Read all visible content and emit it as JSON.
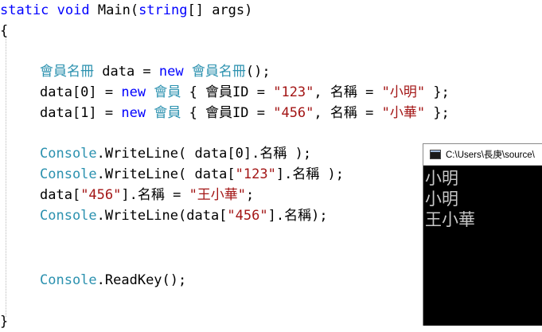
{
  "code": {
    "line1": {
      "static_kw": "static",
      "void_kw": "void",
      "method": "Main(",
      "string_kw": "string",
      "rest": "[] args)"
    },
    "line2": {
      "brace": "{"
    },
    "line3": {
      "type": "會員名冊",
      "mid": " data = ",
      "new_kw": "new",
      "sp": " ",
      "ctor": "會員名冊",
      "end": "();"
    },
    "line4": {
      "start": "data[0] = ",
      "new_kw": "new",
      "sp": " ",
      "type": "會員",
      "mid": " { 會員ID = ",
      "str1": "\"123\"",
      "mid2": ", 名稱 = ",
      "str2": "\"小明\"",
      "end": " };"
    },
    "line5": {
      "start": "data[1] = ",
      "new_kw": "new",
      "sp": " ",
      "type": "會員",
      "mid": " { 會員ID = ",
      "str1": "\"456\"",
      "mid2": ", 名稱 = ",
      "str2": "\"小華\"",
      "end": " };"
    },
    "line6": {
      "type": "Console",
      "mid": ".WriteLine( data[0].名稱 );"
    },
    "line7": {
      "type": "Console",
      "mid": ".WriteLine( data[",
      "str": "\"123\"",
      "end": "].名稱 );"
    },
    "line8": {
      "start": "data[",
      "str1": "\"456\"",
      "mid": "].名稱 = ",
      "str2": "\"王小華\"",
      "end": ";"
    },
    "line9": {
      "type": "Console",
      "mid": ".WriteLine(data[",
      "str": "\"456\"",
      "end": "].名稱);"
    },
    "line10": {
      "type": "Console",
      "mid": ".ReadKey();"
    },
    "line11": {
      "brace": "}"
    }
  },
  "console": {
    "title": "C:\\Users\\長庚\\source\\",
    "output": [
      "小明",
      "小明",
      "王小華"
    ]
  },
  "colors": {
    "keyword": "#0000ff",
    "type": "#2b91af",
    "string": "#a31515",
    "console_bg": "#000000",
    "console_text": "#c8c8c8"
  }
}
